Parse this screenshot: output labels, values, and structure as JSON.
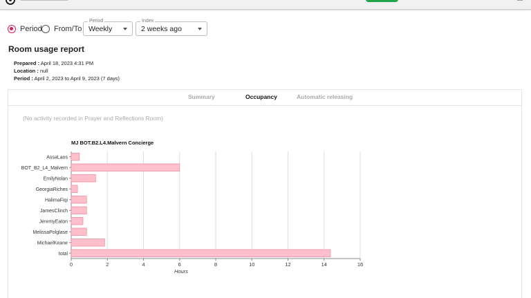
{
  "controls": {
    "radio_period": "Period",
    "radio_fromto": "From/To",
    "period_select": {
      "legend": "Period",
      "value": "Weekly"
    },
    "index_select": {
      "legend": "Index",
      "value": "2 weeks ago"
    }
  },
  "report": {
    "title": "Room usage report",
    "prepared_label": "Prepared :",
    "prepared_value": "April 18, 2023 4:31 PM",
    "location_label": "Location :",
    "location_value": "null",
    "period_label": "Period :",
    "period_value": "April 2, 2023 to April 9, 2023 (7 days)"
  },
  "tabs": [
    "Summary",
    "Occupancy",
    "Automatic releasing"
  ],
  "active_tab": "Occupancy",
  "empty_message": "(No activity recorded in Prayer and Reflections Room)",
  "colors": {
    "bar_fill": "#ffc0cb",
    "bar_stroke": "#ee8ea3",
    "accent": "#d81b60"
  },
  "chart_data": {
    "type": "bar",
    "orientation": "horizontal",
    "title": "MJ BOT.B2.L4.Malvern Concierge",
    "xlabel": "Hours",
    "ylabel": "",
    "categories": [
      "AssaLaos",
      "BOT_B2_L4_Malvern",
      "EmilyNolan",
      "GeorgiaRiches",
      "HalimaFiqi",
      "JamesClinch",
      "JeremyEaton",
      "MelissaPolglase",
      "MichaelKeane",
      "total"
    ],
    "values": [
      0.45,
      6.0,
      1.35,
      0.35,
      0.85,
      0.85,
      0.65,
      0.85,
      1.85,
      14.35
    ],
    "xlim": [
      0,
      16
    ],
    "xticks": [
      0,
      2,
      4,
      6,
      8,
      10,
      12,
      14,
      16
    ],
    "grid": true
  }
}
